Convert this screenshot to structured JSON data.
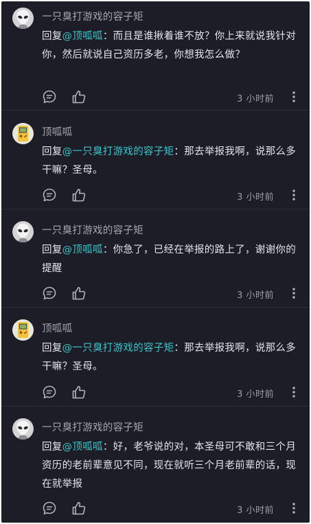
{
  "comments": [
    {
      "avatar": "alien-avatar-icon",
      "username": "一只臭打游戏的容子矩",
      "reply_prefix": "回复",
      "mention": "@顶呱呱",
      "text": "：而且是谁揪着谁不放？你上来就说我针对你，然后就说自己资历多老，你想我怎么做？",
      "time": "3 小时前"
    },
    {
      "avatar": "gameboy-avatar-icon",
      "username": "顶呱呱",
      "reply_prefix": "回复",
      "mention": "@一只臭打游戏的容子矩",
      "text": "：那去举报我啊，说那么多干嘛？圣母。",
      "time": "3 小时前"
    },
    {
      "avatar": "alien-avatar-icon",
      "username": "一只臭打游戏的容子矩",
      "reply_prefix": "回复",
      "mention": "@顶呱呱",
      "text": "：你急了，已经在举报的路上了，谢谢你的提醒",
      "time": "3 小时前"
    },
    {
      "avatar": "gameboy-avatar-icon",
      "username": "顶呱呱",
      "reply_prefix": "回复",
      "mention": "@一只臭打游戏的容子矩",
      "text": "：那去举报我啊，说那么多干嘛？圣母。",
      "time": "3 小时前"
    },
    {
      "avatar": "alien-avatar-icon",
      "username": "一只臭打游戏的容子矩",
      "reply_prefix": "回复",
      "mention": "@顶呱呱",
      "text": "：好，老爷说的对，本圣母可不敢和三个月资历的老前辈意见不同，现在就听三个月老前辈的话，现在就举报",
      "time": "3 小时前"
    }
  ],
  "colors": {
    "background": "#1c1d26",
    "mention": "#3ec5c9",
    "username": "#a6a7ae",
    "body": "#e4e5ea",
    "meta": "#9c9da5"
  }
}
